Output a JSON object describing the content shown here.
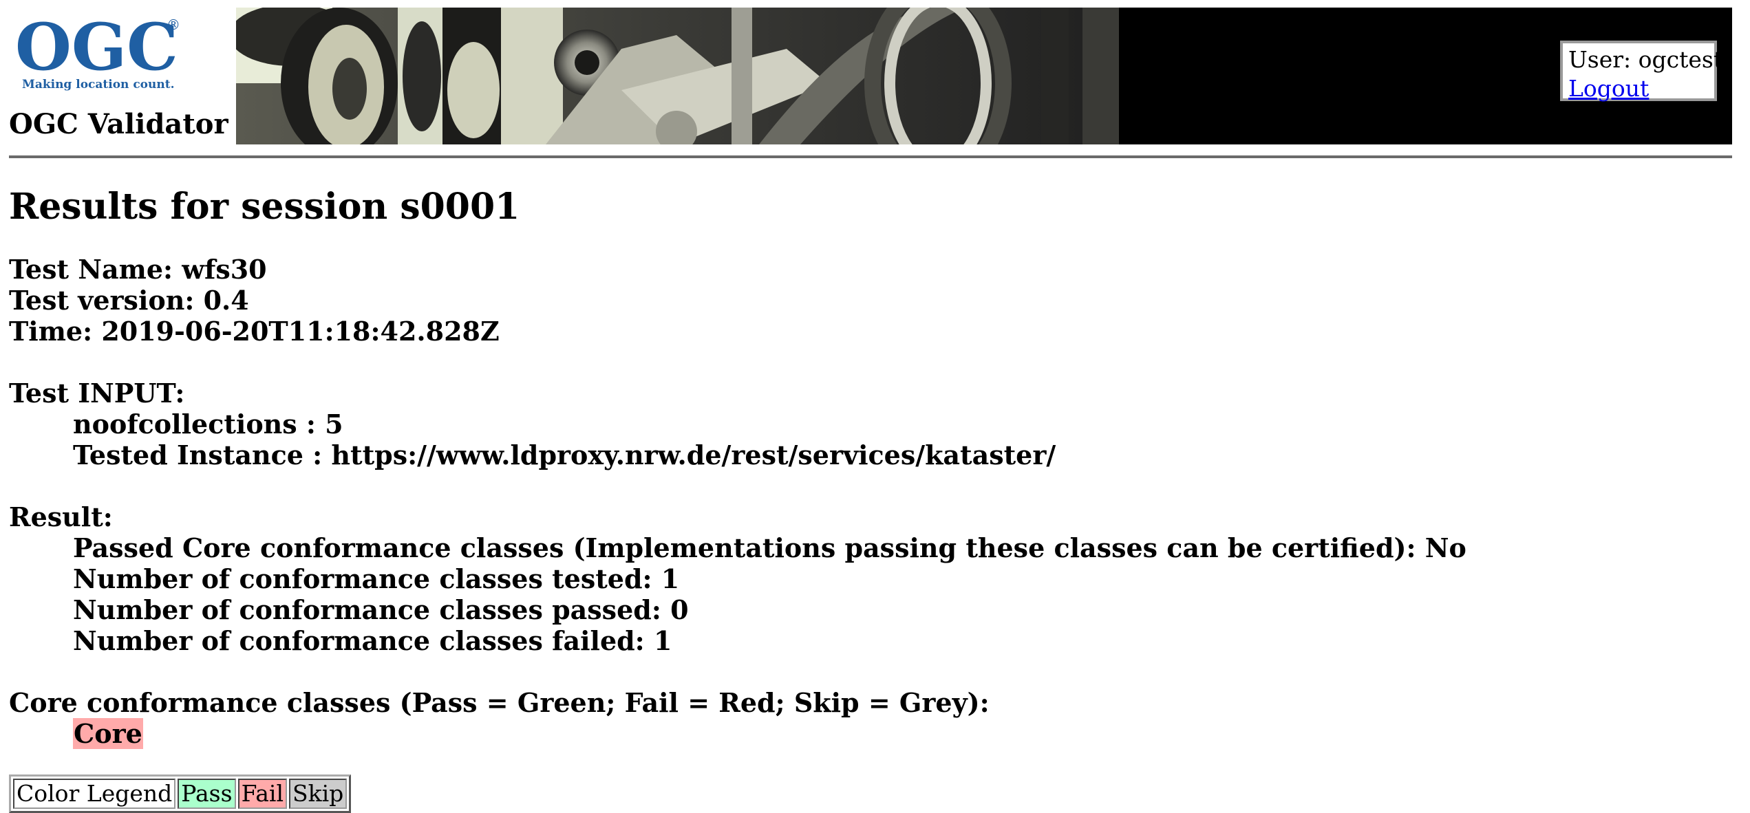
{
  "header": {
    "logo_text": "OGC",
    "logo_registered": "®",
    "logo_tagline": "Making location count.",
    "site_title": "OGC Validator",
    "user_label": "User: ogctest",
    "logout_label": "Logout"
  },
  "page": {
    "title": "Results for session s0001"
  },
  "test": {
    "name": "Test Name: wfs30",
    "version": "Test version: 0.4",
    "time": "Time: 2019-06-20T11:18:42.828Z"
  },
  "input": {
    "heading": "Test INPUT:",
    "items": [
      "noofcollections : 5",
      "Tested Instance : https://www.ldproxy.nrw.de/rest/services/kataster/"
    ]
  },
  "result": {
    "heading": "Result:",
    "items": [
      "Passed Core conformance classes (Implementations passing these classes can be certified): No",
      "Number of conformance classes tested: 1",
      "Number of conformance classes passed: 0",
      "Number of conformance classes failed: 1"
    ]
  },
  "core_classes": {
    "heading": "Core conformance classes (Pass = Green; Fail = Red; Skip = Grey):",
    "items": [
      {
        "label": "Core",
        "status": "fail"
      }
    ]
  },
  "legend": {
    "title": "Color Legend",
    "pass": "Pass",
    "fail": "Fail",
    "skip": "Skip"
  },
  "colors": {
    "pass": "#aaffcc",
    "fail": "#ffaaaa",
    "skip": "#cccccc",
    "link": "#0000ee"
  },
  "icons": {
    "logo": "ogc-logo",
    "banner": "locomotive-wheel-photo"
  }
}
